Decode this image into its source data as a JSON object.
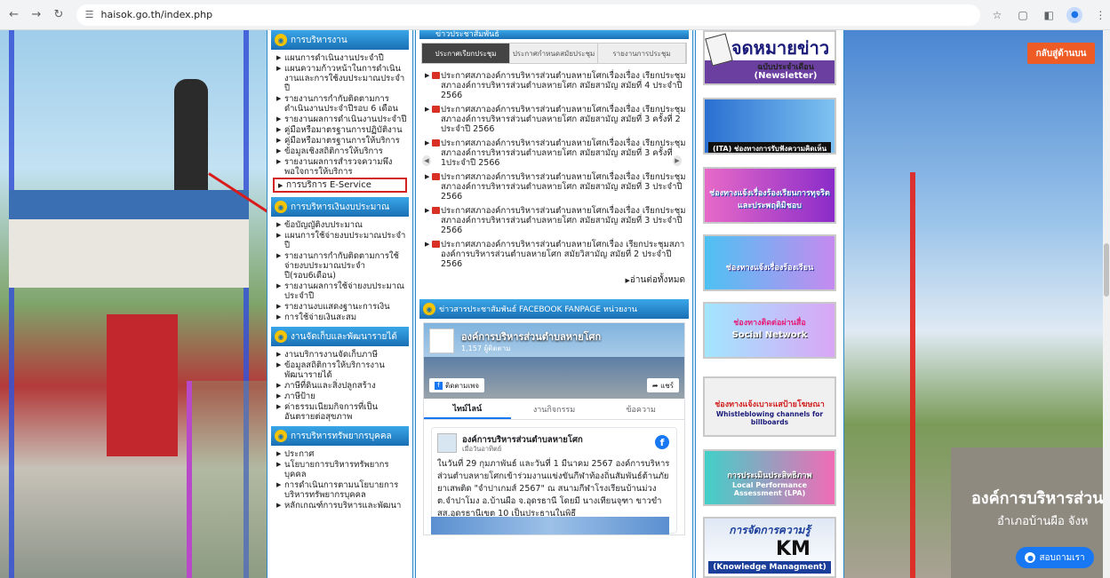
{
  "browser": {
    "url": "haisok.go.th/index.php",
    "back_icon": "arrow-left",
    "forward_icon": "arrow-right",
    "reload_icon": "reload",
    "site_info_icon": "tune",
    "bookmark_icon": "star",
    "extensions_icon": "puzzle",
    "sidebar_icon": "sidebar",
    "menu_icon": "kebab"
  },
  "overlay": {
    "back_button": "กลับสู่ด้านบน",
    "contact_button": "สอบถามเรา"
  },
  "background": {
    "sign_title": "องค์การบริหารส่วน",
    "sign_subtitle": "อำเภอบ้านผือ  จังห"
  },
  "left": {
    "sec1_title": "การบริหารงาน",
    "sec1_items": [
      "แผนการดำเนินงานประจำปี",
      "แผนความก้าวหน้าในการดำเนินงานและการใช้งบประมาณประจำปี",
      "รายงานการกำกับติดตามการดำเนินงานประจำปีรอบ 6 เดือน",
      "รายงานผลการดำเนินงานประจำปี",
      "คู่มือหรือมาตรฐานการปฏิบัติงาน",
      "คู่มือหรือมาตรฐานการให้บริการ",
      "ข้อมูลเชิงสถิติการให้บริการ",
      "รายงานผลการสำรวจความพึงพอใจการให้บริการ",
      "การบริการ E-Service"
    ],
    "sec2_title": "การบริหารเงินงบประมาณ",
    "sec2_items": [
      "ข้อบัญญัติงบประมาณ",
      "แผนการใช้จ่ายงบประมาณประจำปี",
      "รายงานการกำกับติดตามการใช้จ่ายงบประมาณประจำปี(รอบ6เดือน)",
      "รายงานผลการใช้จ่ายงบประมาณประจำปี",
      "รายงานงบแสดงฐานะการเงิน",
      "การใช้จ่ายเงินสะสม"
    ],
    "sec3_title": "งานจัดเก็บและพัฒนารายได้",
    "sec3_items": [
      "งานบริการงานจัดเก็บภาษี",
      "ข้อมูลสถิติการให้บริการงานพัฒนารายได้",
      "ภาษีที่ดินและสิ่งปลูกสร้าง",
      "ภาษีป้าย",
      "ค่าธรรมเนียมกิจการที่เป็นอันตรายต่อสุขภาพ"
    ],
    "sec4_title": "การบริหารทรัพยากรบุคคล",
    "sec4_items": [
      "ประกาศ",
      "นโยบายการบริหารทรัพยากรบุคคล",
      "การดำเนินการตามนโยบายการบริหารทรัพยากรบุคคล",
      "หลักเกณฑ์การบริหารและพัฒนา"
    ]
  },
  "middle": {
    "news_title": "ข่าวประชาสัมพันธ์",
    "tabs": [
      "ประกาศเรียกประชุม",
      "ประกาศกำหนดสมัยประชุม",
      "รายงานการประชุม"
    ],
    "news": [
      "ประกาศสภาองค์การบริหารส่วนตำบลหายโศกเรื่องเรื่อง เรียกประชุมสภาองค์การบริหารส่วนตำบลหายโศก สมัยสามัญ สมัยที่ 4 ประจำปี 2566",
      "ประกาศสภาองค์การบริหารส่วนตำบลหายโศกเรื่องเรื่อง เรียกประชุมสภาองค์การบริหารส่วนตำบลหายโศก สมัยสามัญ สมัยที่ 3 ครั้งที่ 2 ประจำปี 2566",
      "ประกาศสภาองค์การบริหารส่วนตำบลหายโศกเรื่องเรื่อง เรียกประชุมสภาองค์การบริหารส่วนตำบลหายโศก สมัยสามัญ สมัยที่ 3 ครั้งที่ 1ประจำปี 2566",
      "ประกาศสภาองค์การบริหารส่วนตำบลหายโศกเรื่องเรื่อง เรียกประชุมสภาองค์การบริหารส่วนตำบลหายโศก สมัยสามัญ สมัยที่ 3 ประจำปี 2566",
      "ประกาศสภาองค์การบริหารส่วนตำบลหายโศกเรื่องเรื่อง เรียกประชุมสภาองค์การบริหารส่วนตำบลหายโศก สมัยสามัญ สมัยที่ 3 ประจำปี 2566",
      "ประกาศสภาองค์การบริหารส่วนตำบลหายโศกเรื่อง เรียกประชุมสภาองค์การบริหารส่วนตำบลหายโศก สมัยวิสามัญ สมัยที่ 2 ประจำปี 2566"
    ],
    "read_more": "อ่านต่อทั้งหมด",
    "fb_section_title": "ข่าวสารประชาสัมพันธ์ FACEBOOK FANPAGE หน่วยงาน",
    "fb_page_name": "องค์การบริหารส่วนตำบลหายโศก",
    "fb_followers": "1,157 ผู้ติดตาม",
    "fb_follow": "ติดตามเพจ",
    "fb_share": "แชร์",
    "fb_tabs": [
      "ไทม์ไลน์",
      "งานกิจกรรม",
      "ข้อความ"
    ],
    "post_author": "องค์การบริหารส่วนตำบลหายโศก",
    "post_time": "เมื่อวันอาทิตย์",
    "post_body": "ในวันที่ 29 กุมภาพันธ์ และวันที่ 1 มีนาคม 2567 องค์การบริหารส่วนตำบลหายโศกเข้าร่วมงานแข่งขันกีฬาท้องถิ่นสัมพันธ์ต้านภัยยาเสพติด \"จำปาเกมส์ 2567\" ณ สนามกีฬาโรงเรียนบ้านม่วง ต.จำปาโมง อ.บ้านผือ จ.อุดรธานี โดยมี นางเทียนจุฑา ขาวขำ สส.อุดรธานีเขต 10 เป็นประธานในพิธี"
  },
  "right": {
    "bn1_l1": "จดหมายข่าว",
    "bn1_l2": "ฉบับประจำเดือน",
    "bn1_l3": "(Newsletter)",
    "bn2_l1": "(ITA) ช่องทางการรับฟังความคิดเห็น",
    "bn3_l1": "ช่องทางแจ้งเรื่องร้องเรียนการทุจริตและประพฤติมิชอบ",
    "bn4_l1": "ช่องทางแจ้งเรื่องร้องเรียน",
    "bn5_l1": "ช่องทางติดต่อผ่านสื่อ",
    "bn5_l2": "Social Network",
    "bn6_l1": "ช่องทางแจ้งเบาะแสป้ายโฆษณา",
    "bn6_l2": "Whistleblowing channels for billboards",
    "bn7_l1": "การประเมินประสิทธิภาพ",
    "bn7_l2": "Local Performance Assessment (LPA)",
    "bn8_l1": "การจัดการความรู้",
    "bn8_l2": "KM",
    "bn8_l3": "(Knowledge Managment)"
  }
}
